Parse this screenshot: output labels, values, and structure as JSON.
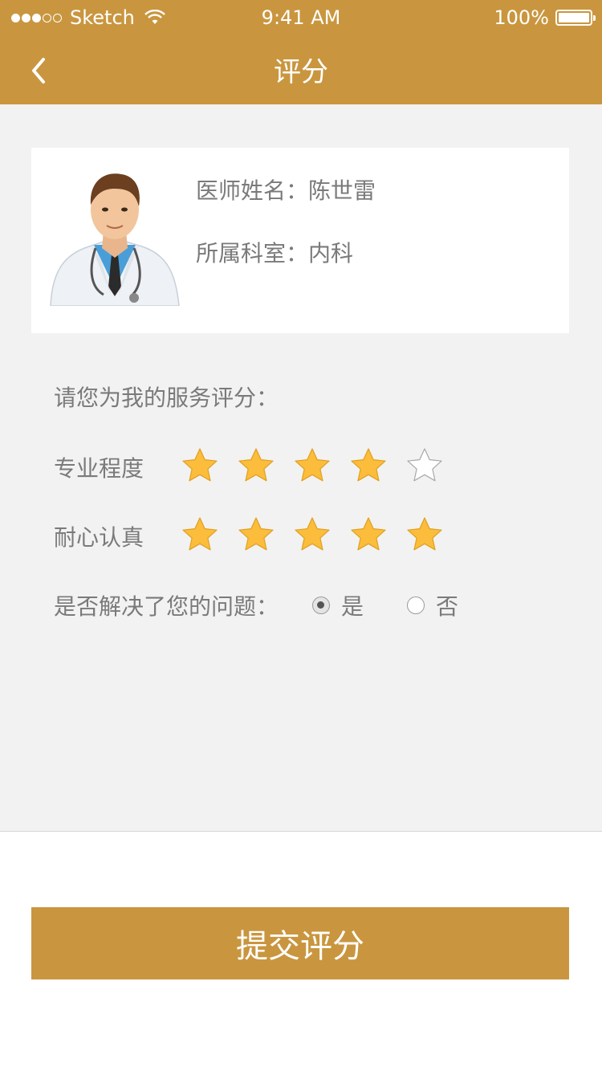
{
  "status_bar": {
    "carrier": "Sketch",
    "time": "9:41 AM",
    "battery": "100%"
  },
  "nav": {
    "title": "评分",
    "back_icon": "chevron-left-icon"
  },
  "doctor": {
    "name_line": "医师姓名：陈世雷",
    "dept_line": "所属科室：内科",
    "avatar": "doctor-avatar"
  },
  "rating": {
    "prompt": "请您为我的服务评分：",
    "items": [
      {
        "label": "专业程度",
        "score": 4,
        "max": 5
      },
      {
        "label": "耐心认真",
        "score": 5,
        "max": 5
      }
    ]
  },
  "question": {
    "label": "是否解决了您的问题：",
    "options": [
      "是",
      "否"
    ],
    "selected": "是"
  },
  "submit": {
    "label": "提交评分"
  },
  "colors": {
    "brand": "#c9963f",
    "star_filled": "#fbbd3b",
    "background": "#f2f2f2"
  }
}
